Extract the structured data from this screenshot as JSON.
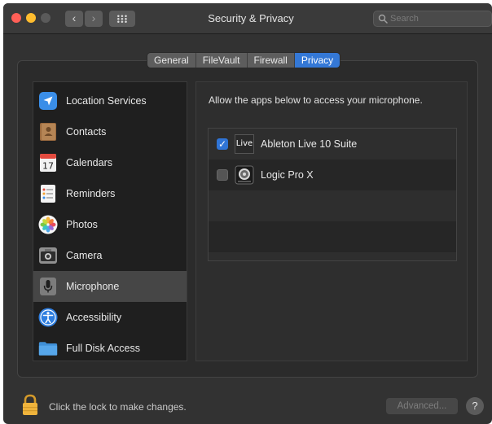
{
  "window": {
    "title": "Security & Privacy",
    "search_placeholder": "Search"
  },
  "tabs": [
    {
      "label": "General",
      "active": false
    },
    {
      "label": "FileVault",
      "active": false
    },
    {
      "label": "Firewall",
      "active": false
    },
    {
      "label": "Privacy",
      "active": true
    }
  ],
  "sidebar": {
    "items": [
      {
        "label": "Location Services",
        "icon": "location-arrow-icon",
        "selected": false
      },
      {
        "label": "Contacts",
        "icon": "contacts-book-icon",
        "selected": false
      },
      {
        "label": "Calendars",
        "icon": "calendar-icon",
        "calendar_day": "17",
        "selected": false
      },
      {
        "label": "Reminders",
        "icon": "reminders-list-icon",
        "selected": false
      },
      {
        "label": "Photos",
        "icon": "photos-flower-icon",
        "selected": false
      },
      {
        "label": "Camera",
        "icon": "camera-icon",
        "selected": false
      },
      {
        "label": "Microphone",
        "icon": "microphone-icon",
        "selected": true
      },
      {
        "label": "Accessibility",
        "icon": "accessibility-icon",
        "selected": false
      },
      {
        "label": "Full Disk Access",
        "icon": "folder-icon",
        "selected": false
      }
    ]
  },
  "content": {
    "description": "Allow the apps below to access your microphone.",
    "apps": [
      {
        "name": "Ableton Live 10 Suite",
        "checked": true,
        "icon": "ableton-live-icon",
        "icon_text": "Live"
      },
      {
        "name": "Logic Pro X",
        "checked": false,
        "icon": "logic-pro-icon"
      }
    ]
  },
  "footer": {
    "lock_text": "Click the lock to make changes.",
    "advanced_label": "Advanced...",
    "help_label": "?"
  },
  "colors": {
    "accent": "#3478d6",
    "close": "#ff5f57",
    "minimize": "#febc2e",
    "lock": "#f0b43c"
  }
}
